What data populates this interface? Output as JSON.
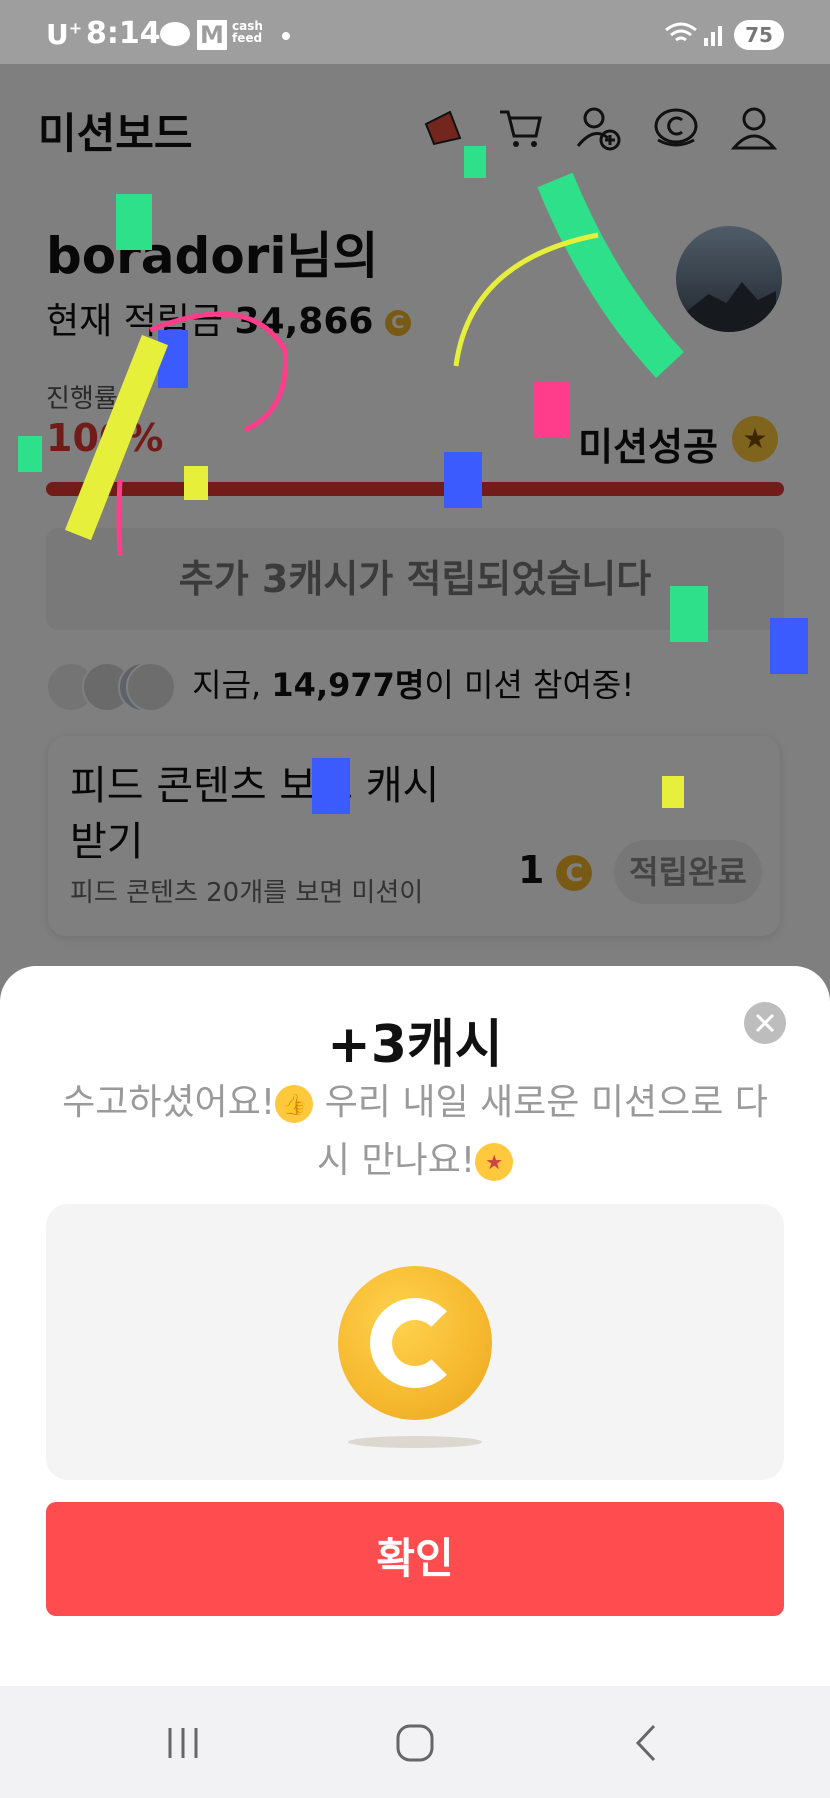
{
  "status_bar": {
    "carrier": "U",
    "carrier_sup": "+",
    "time": "8:14",
    "m_icon": "M",
    "cash_icon_line1": "cash",
    "cash_icon_line2": "feed",
    "battery": "75"
  },
  "header": {
    "title": "미션보드",
    "icons": [
      "megaphone-icon",
      "cart-icon",
      "add-friend-icon",
      "cash-coin-icon",
      "profile-icon"
    ]
  },
  "user": {
    "greeting": "boradori님의",
    "balance_label": "현재 적립금",
    "balance_value": "34,866",
    "coin_symbol": "C"
  },
  "progress": {
    "label": "진행률",
    "value_text": "100%",
    "percent": 100,
    "status": "미션성공",
    "status_emoji": "party-face-emoji"
  },
  "notice": "추가 3캐시가 적립되었습니다",
  "participants": {
    "prefix": "지금, ",
    "count": "14,977명",
    "suffix": "이 미션 참여중!"
  },
  "mission_card": {
    "title": "피드 콘텐츠 보고 캐시 받기",
    "description": "피드 콘텐츠 20개를 보면 미션이",
    "reward": "1",
    "coin_symbol": "C",
    "status_button": "적립완료"
  },
  "sheet": {
    "title": "+3캐시",
    "message_part1": "수고하셨어요!",
    "message_part2": " 우리 내일 새로운 미션으로 다시 만나요!",
    "emoji1": "thumbs-up-emoji",
    "emoji2": "star-struck-emoji",
    "confirm_label": "확인"
  },
  "colors": {
    "accent_red": "#ff4d4f",
    "progress_red": "#e53935",
    "coin_gold": "#f5b82e",
    "confetti": [
      "#2fe08a",
      "#3b5bff",
      "#e6f03a",
      "#ff3d8a"
    ]
  }
}
